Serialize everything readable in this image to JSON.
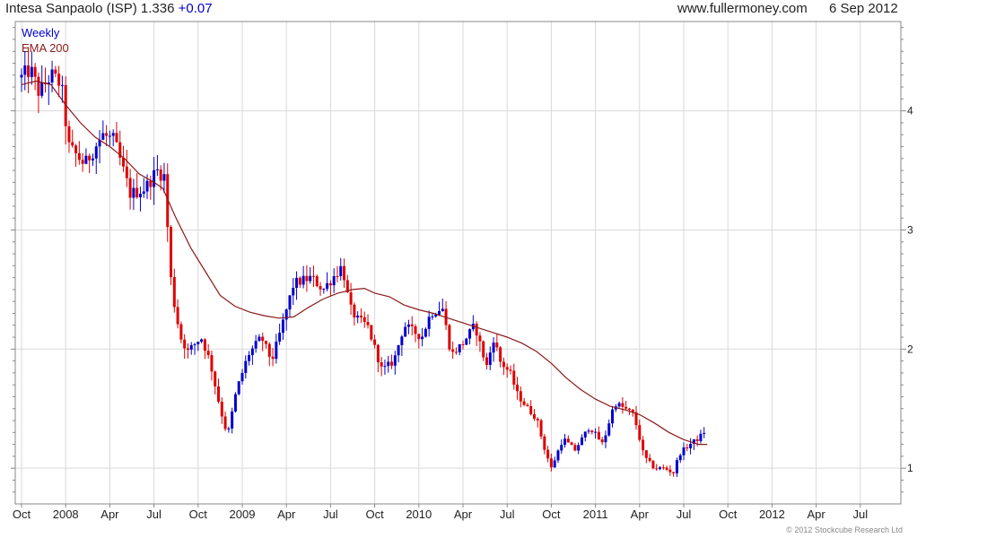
{
  "header": {
    "title": "Intesa Sanpaolo (ISP) 1.336",
    "change": "+0.07",
    "source": "www.fullermoney.com",
    "date": "6 Sep 2012"
  },
  "footer": {
    "credit": "© 2012 Stockcube Research Ltd"
  },
  "colors": {
    "up": "#0000cc",
    "down": "#dd0000",
    "ema": "#8b1a1a",
    "grid": "#d9d9d9",
    "frame": "#888888"
  },
  "chart_data": {
    "type": "candlestick",
    "frequency": "weekly",
    "legend": [
      "Weekly",
      "EMA 200"
    ],
    "y_ticks": [
      "1",
      "2",
      "3",
      "4"
    ],
    "y_range": [
      0.7,
      4.75
    ],
    "x_tick_labels": [
      "Oct",
      "2008",
      "Apr",
      "Jul",
      "Oct",
      "2009",
      "Apr",
      "Jul",
      "Oct",
      "2010",
      "Apr",
      "Jul",
      "Oct",
      "2011",
      "Apr",
      "Jul",
      "Oct",
      "2012",
      "Apr",
      "Jul"
    ],
    "x_range_months": [
      0,
      60
    ],
    "x_ticks_months": [
      0,
      3,
      6,
      9,
      12,
      15,
      18,
      21,
      24,
      27,
      30,
      33,
      36,
      39,
      42,
      45,
      48,
      51,
      54,
      57
    ],
    "anchors": [
      [
        0.0,
        4.28
      ],
      [
        0.6,
        4.35
      ],
      [
        1.2,
        4.15
      ],
      [
        2.0,
        4.3
      ],
      [
        2.7,
        4.22
      ],
      [
        3.2,
        3.7
      ],
      [
        4.3,
        3.55
      ],
      [
        5.5,
        3.8
      ],
      [
        6.3,
        3.75
      ],
      [
        7.4,
        3.3
      ],
      [
        8.4,
        3.35
      ],
      [
        9.2,
        3.5
      ],
      [
        9.7,
        3.45
      ],
      [
        10.2,
        2.5
      ],
      [
        10.8,
        2.1
      ],
      [
        11.3,
        1.98
      ],
      [
        12.2,
        2.1
      ],
      [
        12.8,
        1.9
      ],
      [
        13.5,
        1.5
      ],
      [
        14.0,
        1.27
      ],
      [
        14.6,
        1.65
      ],
      [
        15.4,
        1.95
      ],
      [
        16.3,
        2.1
      ],
      [
        17.0,
        1.9
      ],
      [
        17.6,
        2.15
      ],
      [
        18.5,
        2.55
      ],
      [
        19.7,
        2.6
      ],
      [
        20.5,
        2.5
      ],
      [
        21.8,
        2.7
      ],
      [
        22.3,
        2.35
      ],
      [
        22.8,
        2.25
      ],
      [
        23.5,
        2.2
      ],
      [
        24.5,
        1.82
      ],
      [
        25.3,
        1.9
      ],
      [
        26.0,
        2.2
      ],
      [
        27.2,
        2.1
      ],
      [
        27.8,
        2.3
      ],
      [
        28.6,
        2.35
      ],
      [
        29.2,
        1.95
      ],
      [
        30.0,
        2.05
      ],
      [
        30.8,
        2.2
      ],
      [
        31.6,
        1.85
      ],
      [
        32.1,
        2.1
      ],
      [
        32.5,
        1.9
      ],
      [
        33.2,
        1.8
      ],
      [
        33.7,
        1.62
      ],
      [
        34.4,
        1.5
      ],
      [
        35.0,
        1.42
      ],
      [
        35.5,
        1.18
      ],
      [
        36.0,
        1.0
      ],
      [
        36.8,
        1.25
      ],
      [
        37.6,
        1.15
      ],
      [
        38.6,
        1.35
      ],
      [
        39.5,
        1.2
      ],
      [
        40.3,
        1.55
      ],
      [
        41.0,
        1.5
      ],
      [
        41.6,
        1.45
      ],
      [
        42.3,
        1.1
      ],
      [
        43.0,
        1.0
      ],
      [
        43.7,
        1.0
      ],
      [
        44.3,
        0.96
      ],
      [
        44.7,
        1.12
      ],
      [
        45.4,
        1.2
      ],
      [
        46.0,
        1.25
      ],
      [
        46.6,
        1.336
      ]
    ],
    "ema_points": [
      [
        0.0,
        4.22
      ],
      [
        1.0,
        4.25
      ],
      [
        2.0,
        4.22
      ],
      [
        3.0,
        4.05
      ],
      [
        4.0,
        3.9
      ],
      [
        5.0,
        3.78
      ],
      [
        6.0,
        3.7
      ],
      [
        7.0,
        3.6
      ],
      [
        8.0,
        3.47
      ],
      [
        9.0,
        3.4
      ],
      [
        9.6,
        3.35
      ],
      [
        10.5,
        3.1
      ],
      [
        11.5,
        2.85
      ],
      [
        12.5,
        2.65
      ],
      [
        13.5,
        2.45
      ],
      [
        14.5,
        2.36
      ],
      [
        15.5,
        2.31
      ],
      [
        16.5,
        2.28
      ],
      [
        17.5,
        2.26
      ],
      [
        18.5,
        2.27
      ],
      [
        19.5,
        2.35
      ],
      [
        20.5,
        2.42
      ],
      [
        21.5,
        2.47
      ],
      [
        22.5,
        2.5
      ],
      [
        23.3,
        2.51
      ],
      [
        24.0,
        2.47
      ],
      [
        25.0,
        2.44
      ],
      [
        26.0,
        2.37
      ],
      [
        27.0,
        2.33
      ],
      [
        28.0,
        2.3
      ],
      [
        29.0,
        2.26
      ],
      [
        30.0,
        2.22
      ],
      [
        31.0,
        2.18
      ],
      [
        32.0,
        2.14
      ],
      [
        33.0,
        2.1
      ],
      [
        34.0,
        2.05
      ],
      [
        35.0,
        1.98
      ],
      [
        36.0,
        1.88
      ],
      [
        37.0,
        1.76
      ],
      [
        38.0,
        1.66
      ],
      [
        39.0,
        1.58
      ],
      [
        40.0,
        1.52
      ],
      [
        41.0,
        1.49
      ],
      [
        42.0,
        1.45
      ],
      [
        43.0,
        1.38
      ],
      [
        44.0,
        1.3
      ],
      [
        45.0,
        1.24
      ],
      [
        46.0,
        1.2
      ],
      [
        46.6,
        1.2
      ]
    ]
  }
}
